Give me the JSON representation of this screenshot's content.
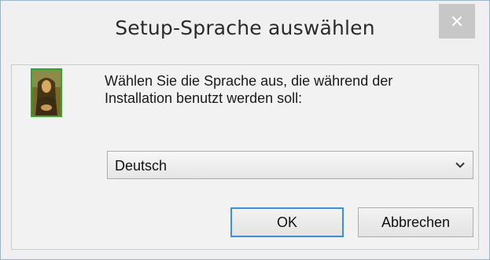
{
  "window": {
    "title": "Setup-Sprache auswählen"
  },
  "content": {
    "prompt_line1": "Wählen Sie die Sprache aus, die während der",
    "prompt_line2": "Installation benutzt werden soll:",
    "icon": "mona-lisa-icon"
  },
  "language_select": {
    "selected": "Deutsch"
  },
  "buttons": {
    "ok": "OK",
    "cancel": "Abbrechen"
  },
  "colors": {
    "focus_border": "#3c8fd8",
    "icon_border": "#2ea62e",
    "close_button_bg": "#c7c7c7"
  }
}
